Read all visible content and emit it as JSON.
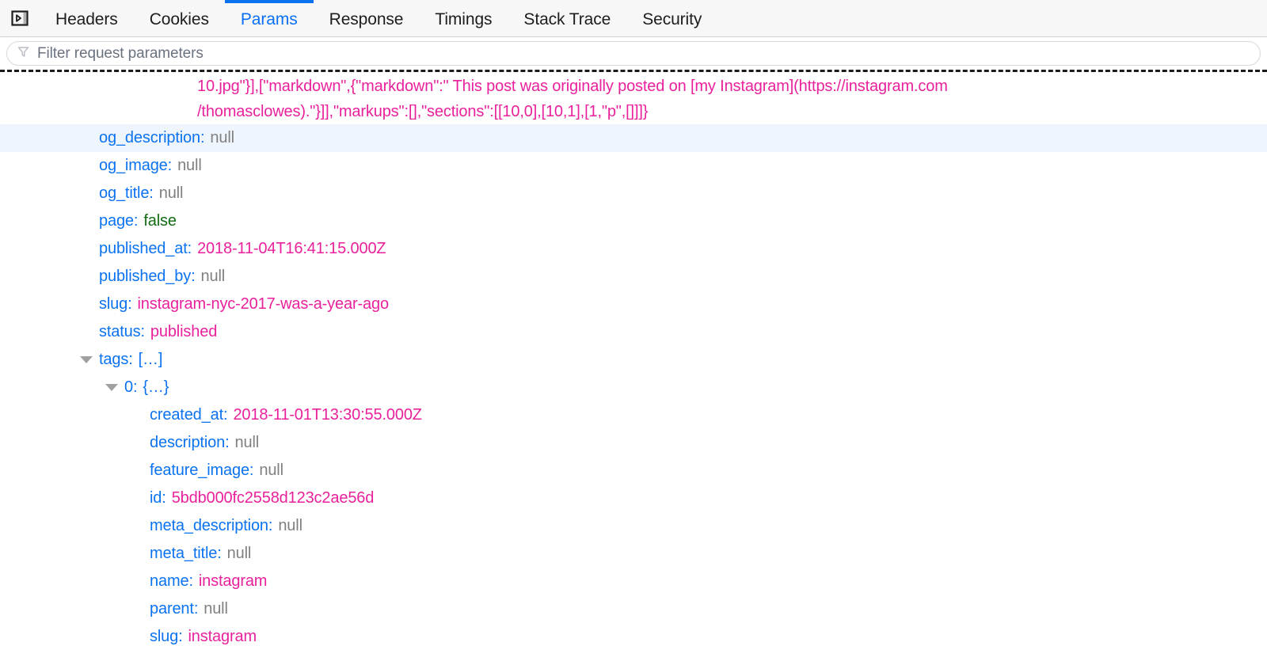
{
  "toolbar": {
    "pane_toggle_icon": "split-pane-icon",
    "tabs": [
      {
        "label": "Headers",
        "active": false
      },
      {
        "label": "Cookies",
        "active": false
      },
      {
        "label": "Params",
        "active": true
      },
      {
        "label": "Response",
        "active": false
      },
      {
        "label": "Timings",
        "active": false
      },
      {
        "label": "Stack Trace",
        "active": false
      },
      {
        "label": "Security",
        "active": false
      }
    ]
  },
  "filter": {
    "icon": "funnel-icon",
    "placeholder": "Filter request parameters",
    "value": ""
  },
  "overflow_text": {
    "line1": "10.jpg\"}],[\"markdown\",{\"markdown\":\" This post was originally posted on [my Instagram](https://instagram.com",
    "line2": "/thomasclowes).\"}]],\"markups\":[],\"sections\":[[10,0],[10,1],[1,\"p\",[]]]}"
  },
  "colors": {
    "key": "#0b72f0",
    "string": "#e9219c",
    "null": "#808080",
    "boolean": "#136d13",
    "accent": "#0b72f0",
    "row_highlight": "#eff5fd"
  },
  "rows": [
    {
      "key": "og_description",
      "colon": ":",
      "value": "null",
      "type": "null",
      "depth": 0,
      "triangle": false,
      "highlight": true
    },
    {
      "key": "og_image",
      "colon": ":",
      "value": "null",
      "type": "null",
      "depth": 0,
      "triangle": false,
      "highlight": false
    },
    {
      "key": "og_title",
      "colon": ":",
      "value": "null",
      "type": "null",
      "depth": 0,
      "triangle": false,
      "highlight": false
    },
    {
      "key": "page",
      "colon": ":",
      "value": "false",
      "type": "bool",
      "depth": 0,
      "triangle": false,
      "highlight": false
    },
    {
      "key": "published_at",
      "colon": ":",
      "value": "2018-11-04T16:41:15.000Z",
      "type": "string",
      "depth": 0,
      "triangle": false,
      "highlight": false
    },
    {
      "key": "published_by",
      "colon": ":",
      "value": "null",
      "type": "null",
      "depth": 0,
      "triangle": false,
      "highlight": false
    },
    {
      "key": "slug",
      "colon": ":",
      "value": "instagram-nyc-2017-was-a-year-ago",
      "type": "string",
      "depth": 0,
      "triangle": false,
      "highlight": false
    },
    {
      "key": "status",
      "colon": ":",
      "value": "published",
      "type": "string",
      "depth": 0,
      "triangle": false,
      "highlight": false
    },
    {
      "key": "tags",
      "colon": ":",
      "value": "[…]",
      "type": "brace",
      "depth": 0,
      "triangle": true,
      "highlight": false
    },
    {
      "key": "0",
      "colon": ":",
      "value": "{…}",
      "type": "brace",
      "depth": 1,
      "triangle": true,
      "highlight": false
    },
    {
      "key": "created_at",
      "colon": ":",
      "value": "2018-11-01T13:30:55.000Z",
      "type": "string",
      "depth": 1,
      "triangle": false,
      "highlight": false
    },
    {
      "key": "description",
      "colon": ":",
      "value": "null",
      "type": "null",
      "depth": 1,
      "triangle": false,
      "highlight": false
    },
    {
      "key": "feature_image",
      "colon": ":",
      "value": "null",
      "type": "null",
      "depth": 1,
      "triangle": false,
      "highlight": false
    },
    {
      "key": "id",
      "colon": ":",
      "value": "5bdb000fc2558d123c2ae56d",
      "type": "string",
      "depth": 1,
      "triangle": false,
      "highlight": false
    },
    {
      "key": "meta_description",
      "colon": ":",
      "value": "null",
      "type": "null",
      "depth": 1,
      "triangle": false,
      "highlight": false
    },
    {
      "key": "meta_title",
      "colon": ":",
      "value": "null",
      "type": "null",
      "depth": 1,
      "triangle": false,
      "highlight": false
    },
    {
      "key": "name",
      "colon": ":",
      "value": "instagram",
      "type": "string",
      "depth": 1,
      "triangle": false,
      "highlight": false
    },
    {
      "key": "parent",
      "colon": ":",
      "value": "null",
      "type": "null",
      "depth": 1,
      "triangle": false,
      "highlight": false
    },
    {
      "key": "slug",
      "colon": ":",
      "value": "instagram",
      "type": "string",
      "depth": 1,
      "triangle": false,
      "highlight": false
    }
  ]
}
